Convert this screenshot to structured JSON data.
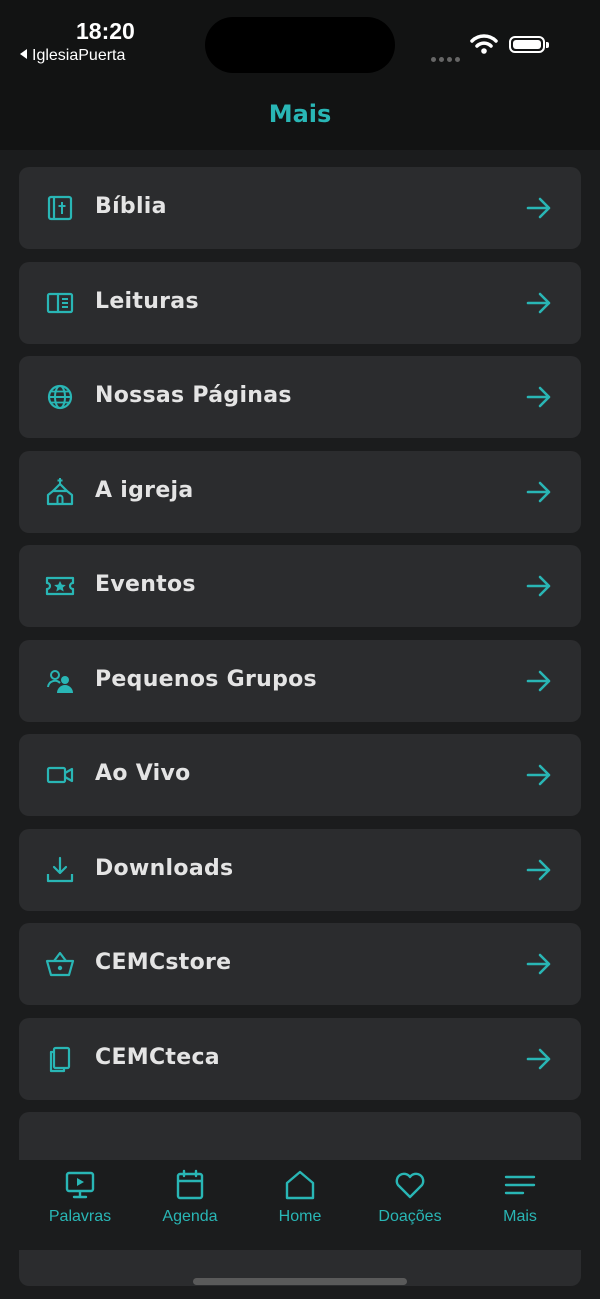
{
  "status_bar": {
    "time": "18:20",
    "back_app": "IglesiaPuerta"
  },
  "header": {
    "title": "Mais"
  },
  "menu": [
    {
      "label": "Bíblia",
      "icon": "bible-icon"
    },
    {
      "label": "Leituras",
      "icon": "book-open-icon"
    },
    {
      "label": "Nossas Páginas",
      "icon": "globe-icon"
    },
    {
      "label": "A igreja",
      "icon": "church-icon"
    },
    {
      "label": "Eventos",
      "icon": "ticket-star-icon"
    },
    {
      "label": "Pequenos Grupos",
      "icon": "group-icon"
    },
    {
      "label": "Ao Vivo",
      "icon": "video-camera-icon"
    },
    {
      "label": "Downloads",
      "icon": "download-icon"
    },
    {
      "label": "CEMCstore",
      "icon": "basket-icon"
    },
    {
      "label": "CEMCteca",
      "icon": "library-icon"
    }
  ],
  "tabs": [
    {
      "label": "Palavras",
      "icon": "monitor-icon"
    },
    {
      "label": "Agenda",
      "icon": "calendar-icon"
    },
    {
      "label": "Home",
      "icon": "home-icon"
    },
    {
      "label": "Doações",
      "icon": "heart-icon"
    },
    {
      "label": "Mais",
      "icon": "menu-lines-icon"
    }
  ],
  "colors": {
    "accent": "#29b6b5",
    "background": "#1b1c1d",
    "card": "#2b2c2e",
    "header": "#121313"
  }
}
